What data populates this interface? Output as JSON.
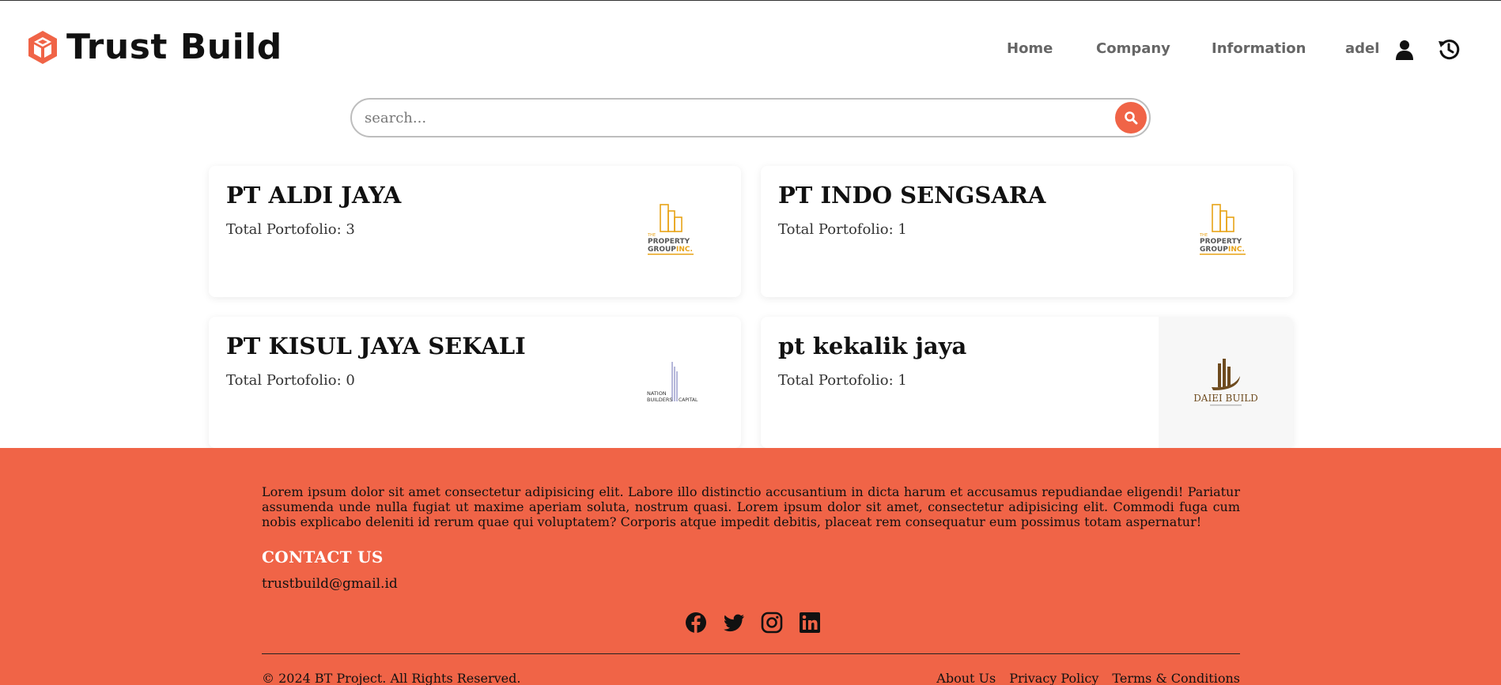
{
  "brand": {
    "name": "Trust Build",
    "logo_icon": "cube-icon",
    "accent_color": "#f06447"
  },
  "nav": {
    "items": [
      {
        "label": "Home"
      },
      {
        "label": "Company"
      },
      {
        "label": "Information"
      }
    ],
    "username": "adel",
    "user_icon": "user-icon",
    "history_icon": "history-icon"
  },
  "search": {
    "placeholder": "search...",
    "value": "",
    "button_icon": "search-icon"
  },
  "companies": [
    {
      "name": "PT ALDI JAYA",
      "portfolio": "Total Portofolio: 3",
      "logo": {
        "line1": "THE",
        "line2": "PROPERTY",
        "line3": "GROUP",
        "line3b": "INC."
      }
    },
    {
      "name": "PT INDO SENGSARA",
      "portfolio": "Total Portofolio: 1",
      "logo": {
        "line1": "THE",
        "line2": "PROPERTY",
        "line3": "GROUP",
        "line3b": "INC."
      }
    },
    {
      "name": "PT KISUL JAYA SEKALI",
      "portfolio": "Total Portofolio: 0",
      "logo": {
        "line1": "NATION",
        "line2": "BUILDERS",
        "line3": "CAPITAL"
      }
    },
    {
      "name": "pt kekalik jaya",
      "portfolio": "Total Portofolio: 1",
      "logo": {
        "line1": "DAIEI BUILD"
      }
    }
  ],
  "footer": {
    "paragraph": "Lorem ipsum dolor sit amet consectetur adipisicing elit. Labore illo distinctio accusantium in dicta harum et accusamus repudiandae eligendi! Pariatur assumenda unde nulla fugiat ut maxime aperiam soluta, nostrum quasi. Lorem ipsum dolor sit amet, consectetur adipisicing elit. Commodi fuga cum nobis explicabo deleniti id rerum quae qui voluptatem? Corporis atque impedit debitis, placeat rem consequatur eum possimus totam aspernatur!",
    "contact_title": "CONTACT US",
    "contact_email": "trustbuild@gmail.id",
    "socials": [
      "facebook-icon",
      "twitter-icon",
      "instagram-icon",
      "linkedin-icon"
    ],
    "copyright": "© 2024 BT Project. All Rights Reserved.",
    "links": [
      {
        "label": "About Us"
      },
      {
        "label": "Privacy Policy"
      },
      {
        "label": "Terms & Conditions"
      }
    ]
  }
}
